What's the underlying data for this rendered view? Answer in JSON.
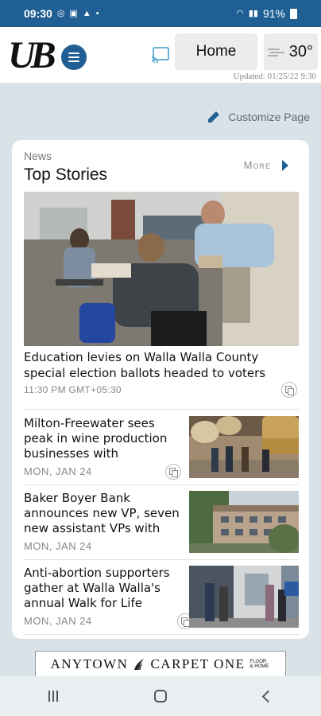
{
  "status_bar": {
    "time": "09:30",
    "battery": "91%",
    "icons": [
      "whatsapp-icon",
      "sim-icon",
      "gallery-icon",
      "alert-icon",
      "dot-icon",
      "wifi-icon",
      "signal-icon",
      "battery-icon"
    ]
  },
  "header": {
    "logo": "UB",
    "home_label": "Home",
    "temperature": "30°",
    "updated": "Updated: 01/25/22 9:30",
    "accent": "#1f5f93"
  },
  "customize_label": "Customize Page",
  "section": {
    "label": "News",
    "title": "Top Stories",
    "more_label": "More"
  },
  "hero": {
    "headline": "Education levies on Walla Walla County special election ballots headed to voters",
    "time": "11:30 PM GMT+05:30"
  },
  "stories": [
    {
      "headline": "Milton-Freewater sees peak in wine production businesses with Watermill...",
      "date": "MON, JAN 24"
    },
    {
      "headline": "Baker Boyer Bank announces new VP, seven new assistant VPs with w...",
      "date": "MON, JAN 24"
    },
    {
      "headline": "Anti-abortion supporters gather at Walla Walla's annual Walk for Life",
      "date": "MON, JAN 24"
    }
  ],
  "ad": {
    "left": "ANYTOWN",
    "right": "CARPET ONE",
    "tag": "FLOOR & HOME"
  }
}
